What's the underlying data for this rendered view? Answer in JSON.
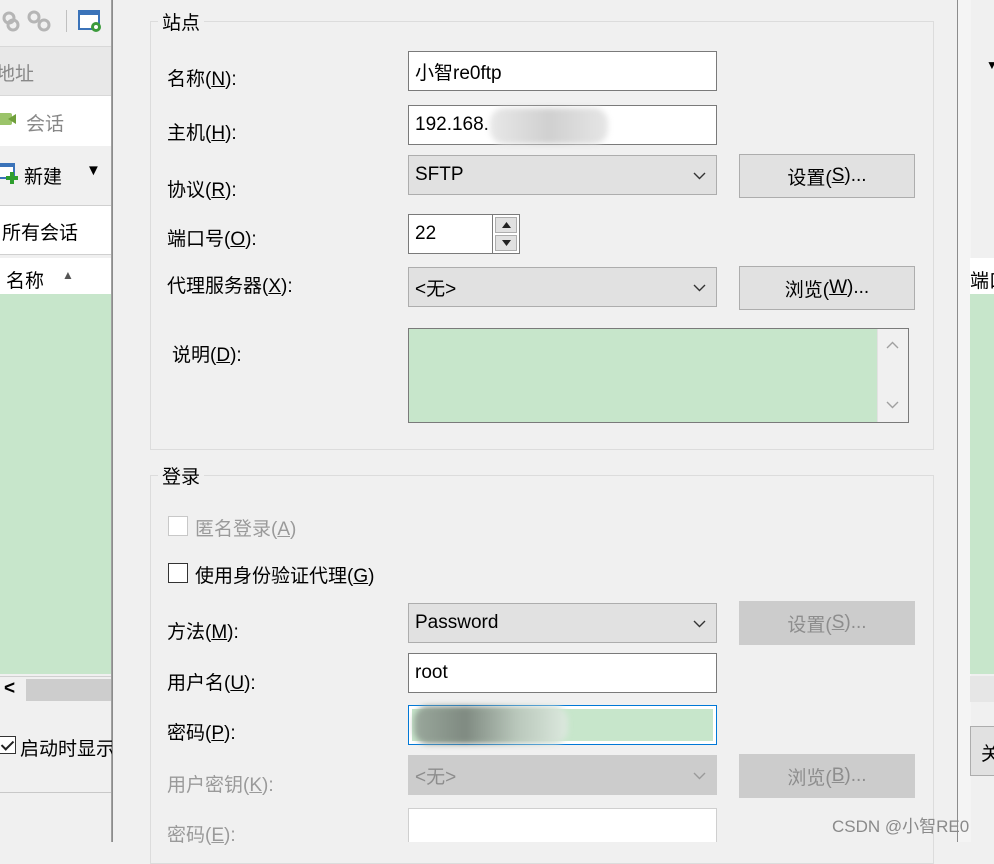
{
  "left_window": {
    "address_label": "地址",
    "session_tab": "会话",
    "new_button": "新建",
    "all_sessions": "所有会话",
    "column_name": "名称",
    "startup_checkbox": "启动时显示",
    "scroll_left": "<"
  },
  "right_window": {
    "column_fragment": "端口",
    "button_fragment": "关闭"
  },
  "site": {
    "legend": "站点",
    "name_label": "名称(",
    "name_key": "N",
    "name_label_end": "):",
    "name_value": "小智re0ftp",
    "host_label": "主机(",
    "host_key": "H",
    "host_label_end": "):",
    "host_value": "192.168.",
    "protocol_label": "协议(",
    "protocol_key": "R",
    "protocol_label_end": "):",
    "protocol_value": "SFTP",
    "settings_button": "设置(",
    "settings_key": "S",
    "settings_button_end": ")...",
    "port_label": "端口号(",
    "port_key": "O",
    "port_label_end": "):",
    "port_value": "22",
    "proxy_label": "代理服务器(",
    "proxy_key": "X",
    "proxy_label_end": "):",
    "proxy_value": "<无>",
    "browse_button": "浏览(",
    "browse_key": "W",
    "browse_button_end": ")...",
    "description_label": "说明(",
    "description_key": "D",
    "description_label_end": "):"
  },
  "login": {
    "legend": "登录",
    "anonymous_label": "匿名登录(",
    "anonymous_key": "A",
    "anonymous_label_end": ")",
    "agent_label": "使用身份验证代理(",
    "agent_key": "G",
    "agent_label_end": ")",
    "method_label": "方法(",
    "method_key": "M",
    "method_label_end": "):",
    "method_value": "Password",
    "method_settings_button": "设置(",
    "method_settings_key": "S",
    "method_settings_end": ")...",
    "username_label": "用户名(",
    "username_key": "U",
    "username_label_end": "):",
    "username_value": "root",
    "password_label": "密码(",
    "password_key": "P",
    "password_label_end": "):",
    "userkey_label": "用户密钥(",
    "userkey_key": "K",
    "userkey_label_end": "):",
    "userkey_value": "<无>",
    "userkey_browse_button": "浏览(",
    "userkey_browse_key": "B",
    "userkey_browse_end": ")...",
    "passphrase_label": "密码(",
    "passphrase_key": "E",
    "passphrase_label_end": "):"
  },
  "watermark": "CSDN @小智RE0",
  "colors": {
    "accent_green": "#c7e6cb",
    "dialog_bg": "#f0f0f0",
    "focus_border": "#0078d7"
  },
  "icons": [
    "link-icon",
    "unlink-icon",
    "settings-window-icon",
    "session-icon",
    "new-session-icon",
    "sort-up-icon",
    "chevron-down-icon",
    "spin-up-icon",
    "spin-down-icon",
    "scroll-up-icon",
    "scroll-down-icon",
    "dropdown-arrow-icon"
  ]
}
